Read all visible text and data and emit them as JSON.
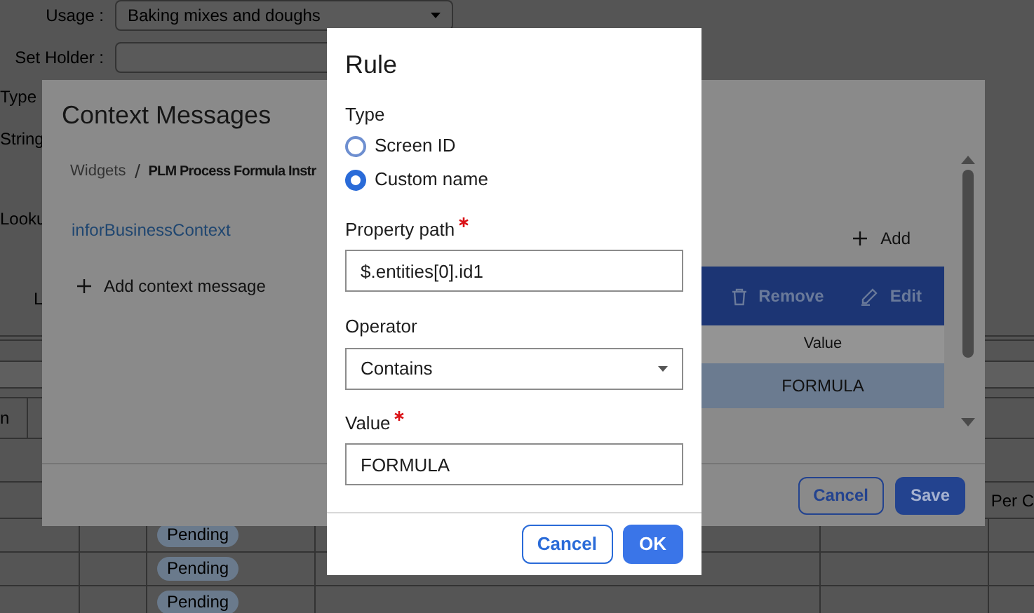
{
  "background": {
    "form_rows": [
      {
        "label": "Usage :",
        "kind": "select",
        "value": "Baking mixes and doughs"
      },
      {
        "label": "Set Holder :",
        "kind": "text"
      },
      {
        "label": "Type",
        "kind": "text"
      },
      {
        "label": "String",
        "kind": "label"
      },
      {
        "label": "Looku",
        "kind": "label"
      },
      {
        "label": "L",
        "kind": "label"
      }
    ],
    "grid_header": "n",
    "table_header": "Per C",
    "rows": [
      {
        "status": "Pending"
      },
      {
        "status": "Pending"
      },
      {
        "status": "Pending"
      }
    ]
  },
  "context_dialog": {
    "title": "Context Messages",
    "breadcrumb": [
      "Widgets",
      "PLM Process Formula Instr"
    ],
    "messages": [
      {
        "label": "inforBusinessContext"
      }
    ],
    "add_message": "Add context message",
    "add": "Add",
    "toolbar": [
      "Remove",
      "Edit"
    ],
    "columns": [
      "Value"
    ],
    "rows": [
      {
        "value": "FORMULA",
        "selected": true
      }
    ],
    "buttons": [
      "Cancel",
      "Save"
    ]
  },
  "rule_dialog": {
    "title": "Rule",
    "type_label": "Type",
    "type_options": [
      {
        "label": "Screen ID",
        "selected": false
      },
      {
        "label": "Custom name",
        "selected": true
      }
    ],
    "property_path": {
      "label": "Property path",
      "required": true,
      "value": "$.entities[0].id1"
    },
    "operator": {
      "label": "Operator",
      "value": "Contains"
    },
    "value": {
      "label": "Value",
      "required": true,
      "value": "FORMULA"
    },
    "buttons": [
      "Cancel",
      "OK"
    ]
  }
}
